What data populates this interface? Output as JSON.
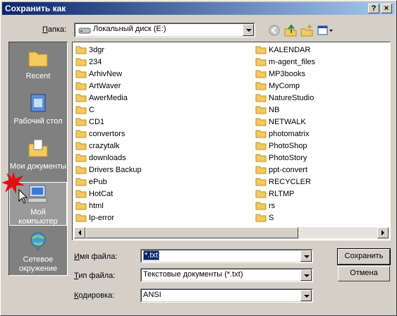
{
  "window": {
    "title": "Сохранить как",
    "help_btn": "?",
    "close_btn": "×"
  },
  "lookin": {
    "label_pre": "",
    "label_u": "П",
    "label_post": "апка:",
    "value": "Локальный диск (E:)"
  },
  "places": [
    {
      "label": "Recent",
      "icon": "recent-folder-icon"
    },
    {
      "label": "Рабочий стол",
      "icon": "desktop-icon"
    },
    {
      "label": "Мои документы",
      "icon": "my-documents-icon"
    },
    {
      "label": "Мой компьютер",
      "icon": "my-computer-icon"
    },
    {
      "label": "Сетевое окружение",
      "icon": "network-icon"
    }
  ],
  "files_col1": [
    "3dgr",
    "234",
    "ArhivNew",
    "ArtWaver",
    "AwerMedia",
    "C",
    "CD1",
    "convertors",
    "crazytalk",
    "downloads",
    "Drivers Backup",
    "ePub",
    "HotCat",
    "html",
    "Ip-error"
  ],
  "files_col2": [
    "KALENDAR",
    "m-agent_files",
    "MP3books",
    "MyComp",
    "NatureStudio",
    "NB",
    "NETWALK",
    "photomatrix",
    "PhotoShop",
    "PhotoStory",
    "ppt-convert",
    "RECYCLER",
    "RLTMP",
    "rs",
    "S"
  ],
  "filename": {
    "label_u": "И",
    "label_post": "мя файла:",
    "value": "*.txt"
  },
  "filetype": {
    "label_u": "Т",
    "label_post": "ип файла:",
    "value": "Текстовые документы (*.txt)"
  },
  "encoding": {
    "label_u": "К",
    "label_post": "одировка:",
    "value": "ANSI"
  },
  "buttons": {
    "save": "Сохранить",
    "cancel": "Отмена"
  },
  "colors": {
    "title_start": "#0a246a",
    "title_end": "#a6caf0",
    "folder": "#f4c95d"
  }
}
